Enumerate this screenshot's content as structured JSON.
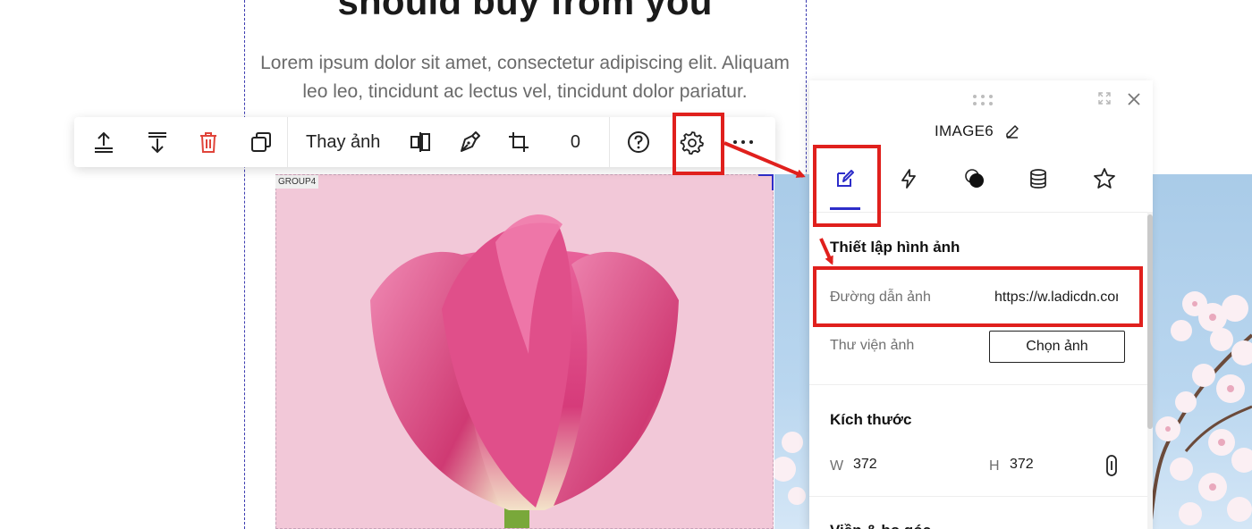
{
  "page": {
    "headline": "should buy from you",
    "subtext": "Lorem ipsum dolor sit amet, consectetur adipiscing elit. Aliquam leo leo, tincidunt ac lectus vel, tincidunt dolor pariatur."
  },
  "canvas": {
    "group_tag": "GROUP4"
  },
  "toolbar": {
    "icons": [
      "move-up-icon",
      "move-down-icon",
      "delete-icon",
      "duplicate-icon",
      "flip-icon",
      "pen-icon",
      "crop-icon",
      "help-icon",
      "settings-icon",
      "more-icon"
    ],
    "replace_image_label": "Thay ảnh",
    "rotation_value": "0",
    "delete_color": "#e0443a"
  },
  "panel": {
    "element_name": "IMAGE6",
    "tabs": [
      "design-tab-icon",
      "events-tab-icon",
      "effects-tab-icon",
      "data-tab-icon",
      "favorite-tab-icon"
    ],
    "active_tab_color": "#2d2dc9",
    "image_settings": {
      "title": "Thiết lập hình ảnh",
      "url_label": "Đường dẫn ảnh",
      "url_value": "https://w.ladicdn.com",
      "library_label": "Thư viện ảnh",
      "choose_button": "Chọn ảnh"
    },
    "size": {
      "title": "Kích thước",
      "w_label": "W",
      "w_value": "372",
      "h_label": "H",
      "h_value": "372"
    },
    "next_section_title": "Viền & bo góc"
  },
  "annotations": {
    "highlight_color": "#e0201d"
  }
}
